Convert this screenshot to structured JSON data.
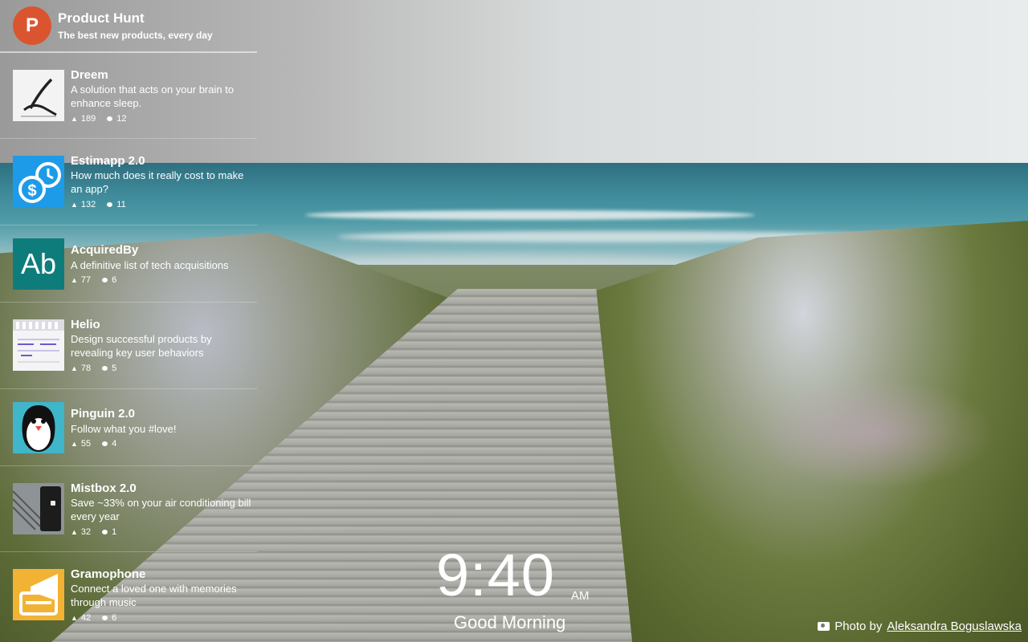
{
  "header": {
    "logo_letter": "P",
    "title": "Product Hunt",
    "tagline": "The best new products, every day"
  },
  "products": [
    {
      "name": "Dreem",
      "description": "A solution that acts on your brain to enhance sleep.",
      "votes": "189",
      "comments": "12",
      "icon": "dreem-logo-icon"
    },
    {
      "name": "Estimapp 2.0",
      "description": "How much does it really cost to make an app?",
      "votes": "132",
      "comments": "11",
      "icon": "estimapp-logo-icon"
    },
    {
      "name": "AcquiredBy",
      "description": "A definitive list of tech acquisitions",
      "votes": "77",
      "comments": "6",
      "icon": "acquiredby-logo-icon",
      "icon_text": "Ab"
    },
    {
      "name": "Helio",
      "description": "Design successful products by revealing key user behaviors",
      "votes": "78",
      "comments": "5",
      "icon": "helio-screenshot-icon"
    },
    {
      "name": "Pinguin 2.0",
      "description": "Follow what you #love!",
      "votes": "55",
      "comments": "4",
      "icon": "pinguin-logo-icon"
    },
    {
      "name": "Mistbox 2.0",
      "description": "Save ~33% on your air conditioning bill every year",
      "votes": "32",
      "comments": "1",
      "icon": "mistbox-product-icon"
    },
    {
      "name": "Gramophone",
      "description": "Connect a loved one with memories through music",
      "votes": "42",
      "comments": "6",
      "icon": "gramophone-logo-icon"
    }
  ],
  "clock": {
    "time": "9:40",
    "ampm": "AM",
    "greeting": "Good Morning"
  },
  "credit": {
    "prefix": "Photo by",
    "author": "Aleksandra Boguslawska"
  },
  "colors": {
    "brand": "#da552f",
    "estimapp": "#1e9be8",
    "acquiredby": "#0f7c7c",
    "pinguin": "#3fb6c9",
    "gramophone": "#f2b234"
  }
}
